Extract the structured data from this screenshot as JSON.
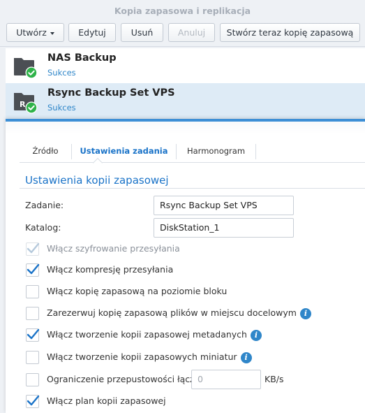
{
  "window": {
    "title": "Kopia zapasowa i replikacja"
  },
  "toolbar": {
    "create": "Utwórz",
    "edit": "Edytuj",
    "delete": "Usuń",
    "cancel": "Anuluj",
    "backup_now": "Stwórz teraz kopię zapasową"
  },
  "tasks": [
    {
      "name": "NAS Backup",
      "status": "Sukces",
      "icon": "folder-success-icon"
    },
    {
      "name": "Rsync Backup Set VPS",
      "status": "Sukces",
      "icon": "rsync-folder-success-icon",
      "folder_letter": "R"
    }
  ],
  "tabs": [
    "Źródło",
    "Ustawienia zadania",
    "Harmonogram"
  ],
  "active_tab": "Ustawienia zadania",
  "settings": {
    "section_title": "Ustawienia kopii zapasowej",
    "task_label": "Zadanie:",
    "task_value": "Rsync Backup Set VPS",
    "directory_label": "Katalog:",
    "directory_value": "DiskStation_1",
    "options": [
      {
        "label": "Włącz szyfrowanie przesyłania",
        "checked": true,
        "disabled": true
      },
      {
        "label": "Włącz kompresję przesyłania",
        "checked": true
      },
      {
        "label": "Włącz kopię zapasową na poziomie bloku",
        "checked": false
      },
      {
        "label": "Zarezerwuj kopię zapasową plików w miejscu docelowym",
        "checked": false,
        "info": true
      },
      {
        "label": "Włącz tworzenie kopii zapasowej metadanych",
        "checked": true,
        "info": true
      },
      {
        "label": "Włącz tworzenie kopii zapasowych miniatur",
        "checked": false,
        "info": true
      },
      {
        "label": "Ograniczenie przepustowości łącza",
        "checked": false
      },
      {
        "label": "Włącz plan kopii zapasowej",
        "checked": true
      }
    ],
    "bandwidth_value": "0",
    "bandwidth_unit": "KB/s"
  },
  "colors": {
    "accent": "#1a73c8",
    "success": "#2fb34a",
    "selected_row": "#deebf6",
    "folder": "#4b4f54"
  }
}
